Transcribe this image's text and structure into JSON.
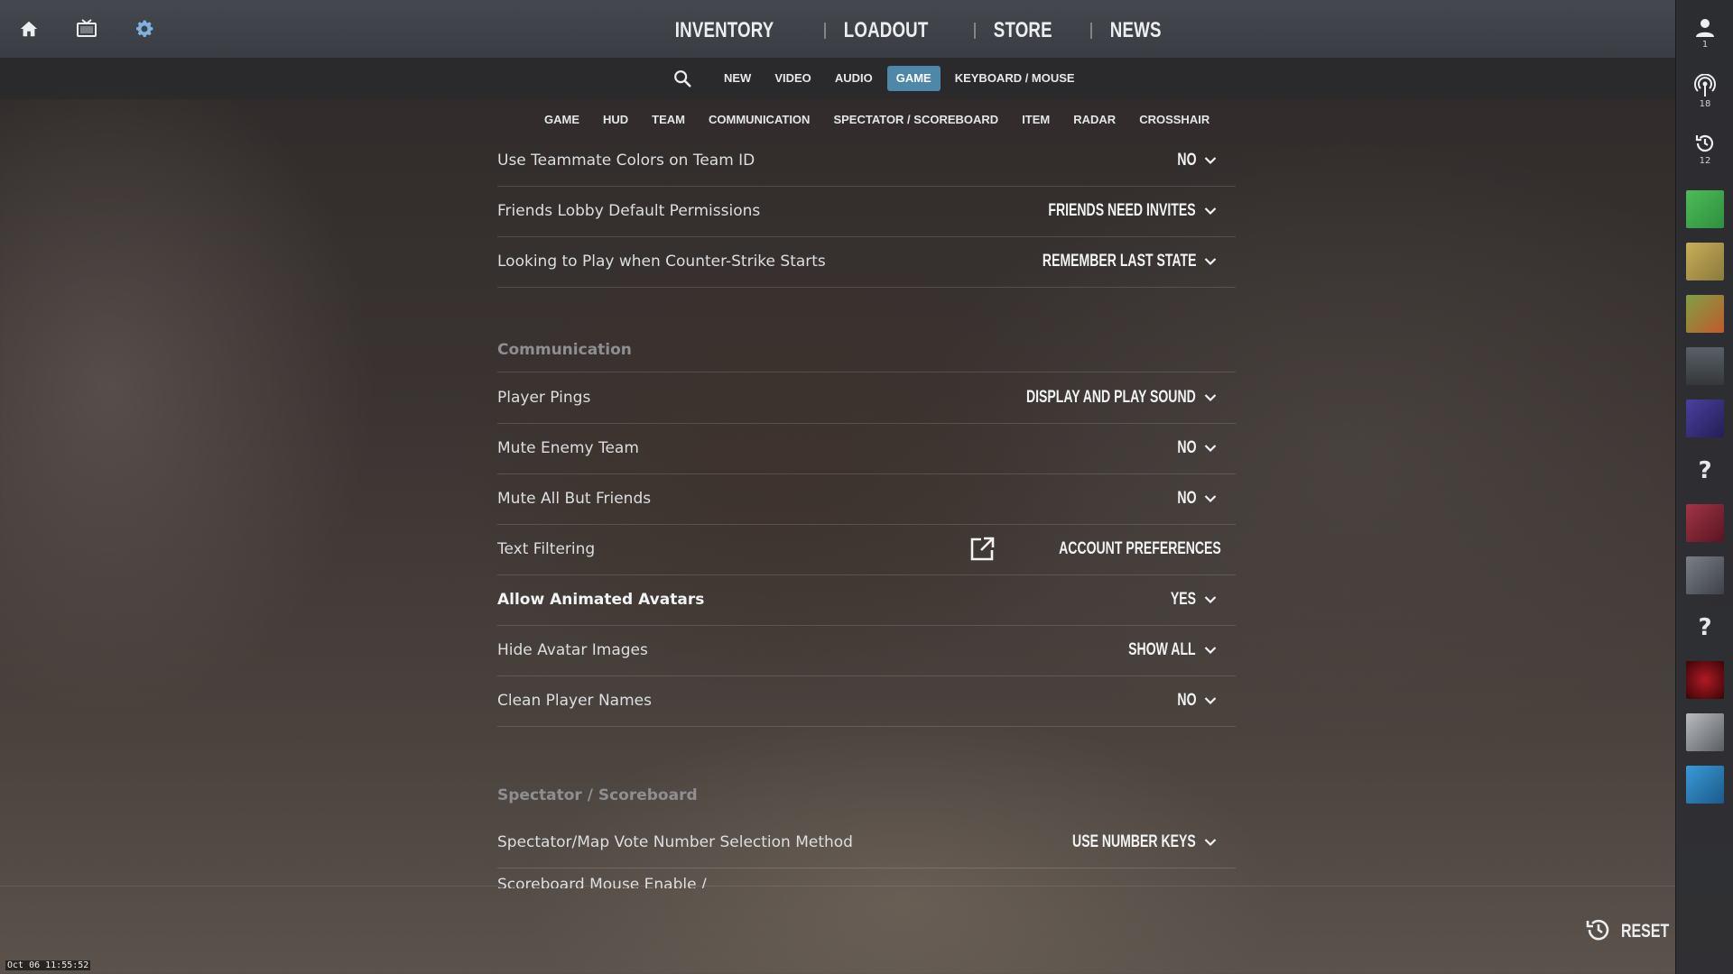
{
  "top_nav": {
    "items": [
      "INVENTORY",
      "LOADOUT",
      "STORE",
      "NEWS"
    ],
    "icons": [
      "home-icon",
      "tv-icon",
      "gear-icon"
    ]
  },
  "tabs": {
    "items": [
      "NEW",
      "VIDEO",
      "AUDIO",
      "GAME",
      "KEYBOARD / MOUSE"
    ],
    "active": "GAME"
  },
  "subtabs": [
    "GAME",
    "HUD",
    "TEAM",
    "COMMUNICATION",
    "SPECTATOR / SCOREBOARD",
    "ITEM",
    "RADAR",
    "CROSSHAIR"
  ],
  "settings": {
    "rows_top": [
      {
        "label": "Use Teammate Colors on Team ID",
        "value": "NO"
      },
      {
        "label": "Friends Lobby Default Permissions",
        "value": "FRIENDS NEED INVITES"
      },
      {
        "label": "Looking to Play when Counter-Strike Starts",
        "value": "REMEMBER LAST STATE"
      }
    ],
    "communication_title": "Communication",
    "communication": [
      {
        "label": "Player Pings",
        "value": "DISPLAY AND PLAY SOUND"
      },
      {
        "label": "Mute Enemy Team",
        "value": "NO"
      },
      {
        "label": "Mute All But Friends",
        "value": "NO"
      },
      {
        "label": "Text Filtering",
        "value": "ACCOUNT PREFERENCES"
      },
      {
        "label": "Allow Animated Avatars",
        "value": "YES"
      },
      {
        "label": "Hide Avatar Images",
        "value": "SHOW ALL"
      },
      {
        "label": "Clean Player Names",
        "value": "NO"
      }
    ],
    "spectator_title": "Spectator / Scoreboard",
    "spectator": [
      {
        "label": "Spectator/Map Vote Number Selection Method",
        "value": "USE NUMBER KEYS"
      },
      {
        "label": "Scoreboard Mouse Enable /",
        "value": ""
      }
    ]
  },
  "sidebar": {
    "profile_count": "1",
    "broadcast_count": "18",
    "recent_count": "12",
    "unknown_glyph": "?",
    "avatar_colors": [
      "#3fa34d",
      "#b59a4a",
      "#6a8a3a",
      "#4a4f55",
      "#3b3470",
      "#ffffff",
      "#8a2a3a",
      "#6a6e75",
      "#ffffff",
      "#6a0e14",
      "#8a8e92",
      "#2a7ab0"
    ]
  },
  "reset_label": "RESET",
  "clock": "Oct 06 11:55:52",
  "colors": {
    "active_tab": "#4f87a8",
    "settings_gear": "#7fb2e0"
  }
}
